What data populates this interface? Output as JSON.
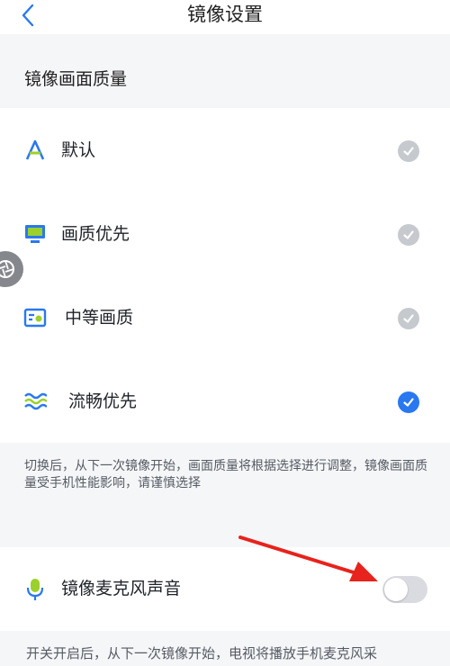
{
  "nav": {
    "title": "镜像设置",
    "back_icon": "chevron-left-icon"
  },
  "section": {
    "quality_header": "镜像画面质量"
  },
  "quality_options": [
    {
      "label": "默认",
      "icon": "font-a-icon",
      "selected": false
    },
    {
      "label": "画质优先",
      "icon": "monitor-icon",
      "selected": false
    },
    {
      "label": "中等画质",
      "icon": "image-card-icon",
      "selected": false
    },
    {
      "label": "流畅优先",
      "icon": "waves-icon",
      "selected": true
    }
  ],
  "notes": {
    "quality_note": "切换后，从下一次镜像开始，画面质量将根据选择进行调整，镜像画面质量受手机性能影响，请谨慎选择",
    "mic_note": "开关开启后，从下一次镜像开始，电视将播放手机麦克风采"
  },
  "mic": {
    "label": "镜像麦克风声音",
    "icon": "microphone-icon",
    "toggle_on": false
  },
  "colors": {
    "accent": "#2a78f0",
    "check_inactive": "#c6c9ce",
    "annotation": "#e8221c"
  }
}
